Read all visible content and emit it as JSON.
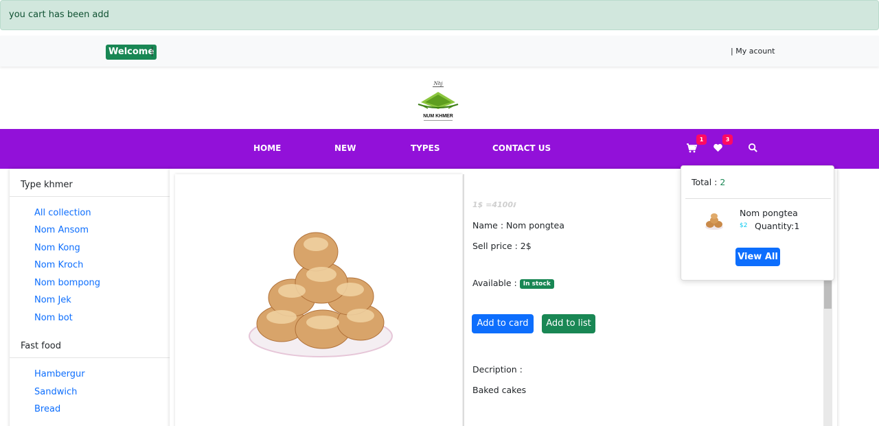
{
  "alert": {
    "message": "you cart has been add"
  },
  "topbar": {
    "welcome_label": "Welcome",
    "account_label": "| My acount"
  },
  "brand": {
    "logo_text": "NUM KHMER"
  },
  "nav": {
    "items": [
      {
        "label": "HOME"
      },
      {
        "label": "NEW"
      },
      {
        "label": "TYPES"
      },
      {
        "label": "CONTACT US"
      }
    ],
    "cart_count": "1",
    "wishlist_count": "3",
    "icons": [
      "cart-icon",
      "heart-icon",
      "search-icon"
    ]
  },
  "sidebar": {
    "groups": [
      {
        "title": "Type khmer",
        "items": [
          "All collection",
          "Nom Ansom",
          "Nom Kong",
          "Nom Kroch",
          "Nom bompong",
          "Nom Jek",
          "Nom bot"
        ]
      },
      {
        "title": "Fast food",
        "items": [
          "Hambergur",
          "Sandwich",
          "Bread"
        ]
      }
    ]
  },
  "product": {
    "exchange_rate": "1$ =4100៛",
    "name_line": "Name : Nom pongtea",
    "price_line": "Sell price : 2$",
    "available_label": "Available :",
    "stock_badge": "In stock",
    "add_to_cart_label": "Add to card",
    "add_to_list_label": "Add to list",
    "description_label": "Decription :",
    "description_text": "Baked cakes"
  },
  "cart_dropdown": {
    "total_label": "Total :",
    "total_value": "2",
    "item_name": "Nom pongtea",
    "item_price": "$2",
    "item_quantity": "Quantity:1",
    "view_all_label": "View All"
  },
  "colors": {
    "nav_bg": "#9211d9",
    "alert_bg": "#d1e7dd",
    "primary": "#0d6efd",
    "success": "#198754",
    "badge": "#ff0a62"
  }
}
